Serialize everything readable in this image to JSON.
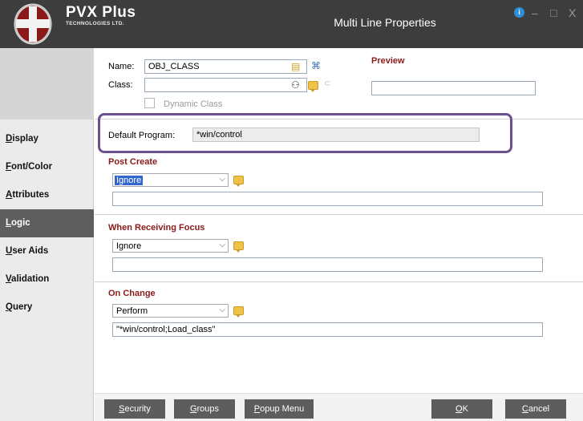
{
  "window": {
    "brand_name": "PVX Plus",
    "brand_sub": "TECHNOLOGIES LTD.",
    "title": "Multi Line Properties",
    "info_icon": "i",
    "minimize_icon": "–",
    "maximize_icon": "□",
    "close_icon": "X"
  },
  "sidebar": {
    "items": [
      {
        "label": "Display",
        "mnemonic": "D",
        "rest": "isplay",
        "active": false
      },
      {
        "label": "Font/Color",
        "mnemonic": "F",
        "rest": "ont/Color",
        "active": false
      },
      {
        "label": "Attributes",
        "mnemonic": "A",
        "rest": "ttributes",
        "active": false
      },
      {
        "label": "Logic",
        "mnemonic": "L",
        "rest": "ogic",
        "active": true
      },
      {
        "label": "User Aids",
        "mnemonic": "U",
        "rest": "ser Aids",
        "active": false
      },
      {
        "label": "Validation",
        "mnemonic": "V",
        "rest": "alidation",
        "active": false
      },
      {
        "label": "Query",
        "mnemonic": "Q",
        "rest": "uery",
        "active": false
      }
    ]
  },
  "header": {
    "name_label": "Name:",
    "name_value": "OBJ_CLASS",
    "class_label": "Class:",
    "class_value": "",
    "dynamic_class_label": "Dynamic Class",
    "preview_label": "Preview",
    "preview_value": ""
  },
  "default_program": {
    "label": "Default Program:",
    "value": "*win/control"
  },
  "post_create": {
    "title": "Post Create",
    "action": "Ignore",
    "value": ""
  },
  "receiving_focus": {
    "title": "When Receiving Focus",
    "action": "Ignore",
    "value": ""
  },
  "on_change": {
    "title": "On Change",
    "action": "Perform",
    "value": "\"*win/control;Load_class\""
  },
  "buttons": {
    "security": {
      "mnemonic": "S",
      "rest": "ecurity"
    },
    "groups": {
      "mnemonic": "G",
      "rest": "roups"
    },
    "popup_menu": {
      "mnemonic": "P",
      "rest": "opup Menu"
    },
    "ok": {
      "mnemonic": "O",
      "rest": "K"
    },
    "cancel": {
      "mnemonic": "C",
      "rest": "ancel"
    }
  },
  "colors": {
    "titlebar": "#3d3d3d",
    "section_title": "#8b1a1a",
    "highlight_border": "#6b5090",
    "active_sidebar": "#5e5e5e",
    "selected_option": "#3366cc"
  }
}
